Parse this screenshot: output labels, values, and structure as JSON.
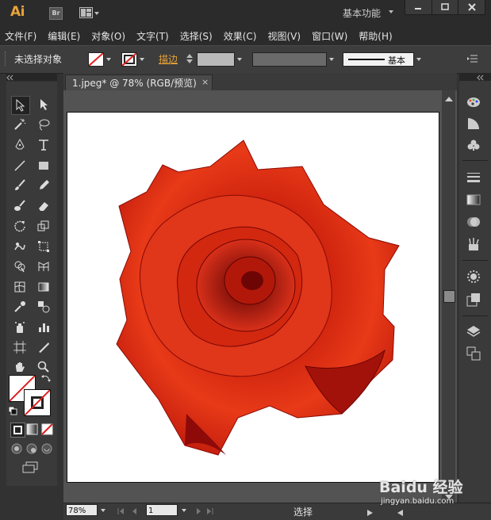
{
  "app": {
    "logo": "Ai",
    "bridge_label": "Br",
    "workspace_label": "基本功能"
  },
  "menu": [
    "文件(F)",
    "编辑(E)",
    "对象(O)",
    "文字(T)",
    "选择(S)",
    "效果(C)",
    "视图(V)",
    "窗口(W)",
    "帮助(H)"
  ],
  "control": {
    "selection_status": "未选择对象",
    "stroke_label": "描边",
    "stroke_style": "基本"
  },
  "document": {
    "tab_title": "1.jpeg* @ 78% (RGB/预览)",
    "tab_close": "×"
  },
  "status": {
    "zoom": "78%",
    "page": "1",
    "tool_label": "选择"
  },
  "watermark": {
    "brand": "Baidu 经验",
    "url": "jingyan.baidu.com"
  },
  "colors": {
    "accent_orange": "#e8a33a",
    "rose_red": "#d42a10",
    "panel_dark": "#323232"
  },
  "icons": {
    "tools": [
      "selection-icon",
      "direct-selection-icon",
      "magic-wand-icon",
      "lasso-icon",
      "pen-icon",
      "type-icon",
      "line-icon",
      "rectangle-icon",
      "paintbrush-icon",
      "pencil-icon",
      "blob-brush-icon",
      "eraser-icon",
      "rotate-icon",
      "scale-icon",
      "warp-icon",
      "free-transform-icon",
      "shape-builder-icon",
      "perspective-grid-icon",
      "mesh-icon",
      "gradient-icon",
      "eyedropper-icon",
      "blend-icon",
      "symbol-sprayer-icon",
      "column-graph-icon",
      "artboard-icon",
      "slice-icon",
      "hand-icon",
      "zoom-icon"
    ],
    "right_panel": [
      "color-palette-icon",
      "color-guide-icon",
      "swatches-icon",
      "stroke-icon",
      "gradient-panel-icon",
      "transparency-icon",
      "brushes-icon",
      "appearance-icon",
      "graphic-styles-icon",
      "layers-icon",
      "artboards-icon"
    ]
  }
}
